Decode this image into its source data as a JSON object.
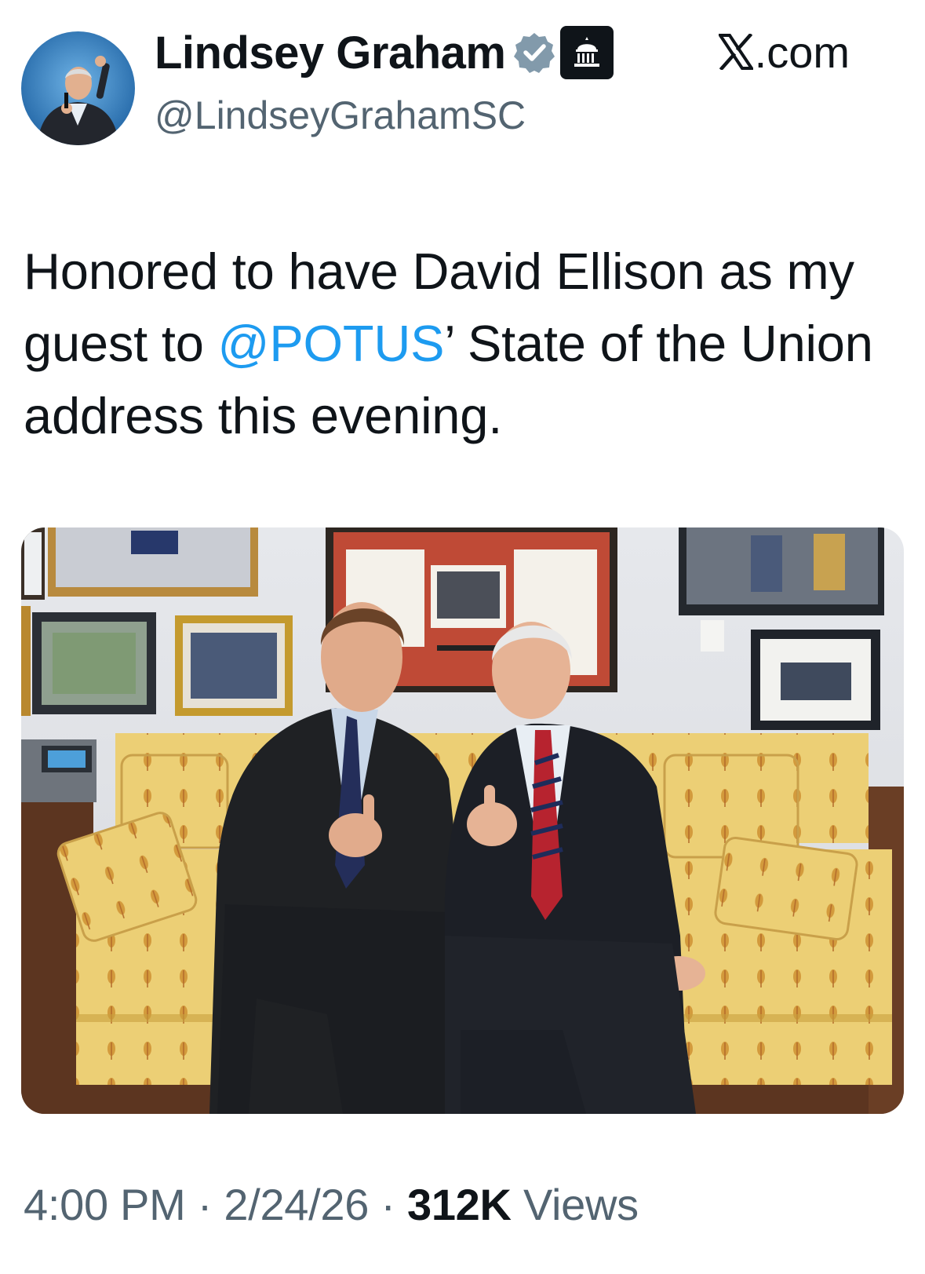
{
  "author": {
    "display_name": "Lindsey Graham",
    "handle": "@LindseyGrahamSC",
    "avatar_icon": "profile-photo",
    "verified_icon": "verified-badge-icon",
    "affiliation_icon": "government-capitol-icon"
  },
  "brand": {
    "logo_icon": "x-logo-icon",
    "label": ".com"
  },
  "tweet": {
    "text_before": "Honored to have David Ellison as my guest to ",
    "mention": "@POTUS",
    "text_after": "’ State of the Union address this evening."
  },
  "media": {
    "type": "photo"
  },
  "meta": {
    "time": "4:00 PM",
    "separator": "·",
    "date": "2/24/26",
    "views_count": "312K",
    "views_label": "Views"
  },
  "colors": {
    "link": "#1d9bf0",
    "text": "#0f1419",
    "secondary": "#536471",
    "verified_gray": "#829aab"
  }
}
